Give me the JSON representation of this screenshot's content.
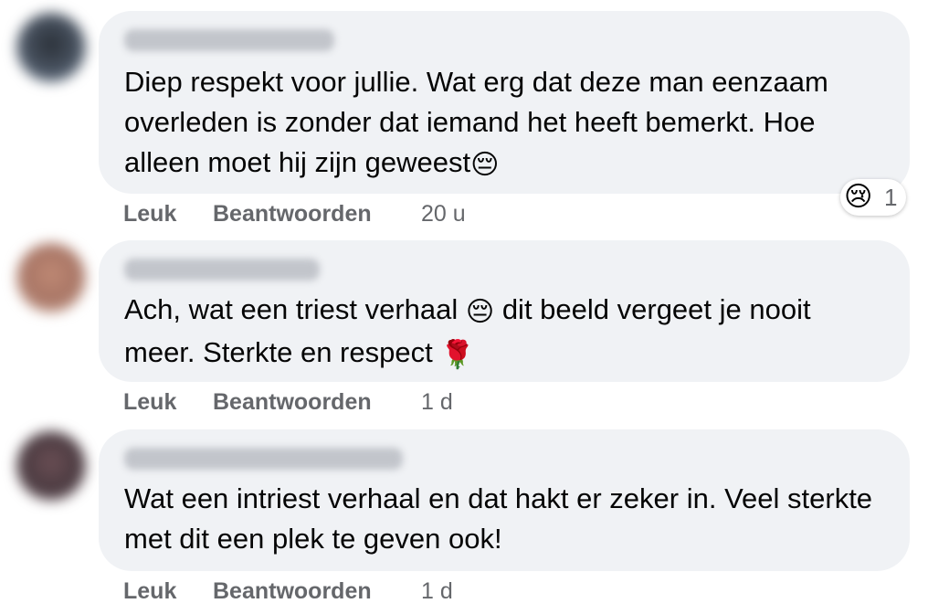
{
  "comments": [
    {
      "text": "Diep respekt voor jullie. Wat erg dat deze man eenzaam overleden is zonder dat iemand het heeft bemerkt. Hoe alleen moet hij zijn geweest",
      "emoji": "😔",
      "like_label": "Leuk",
      "reply_label": "Beantwoorden",
      "time": "20 u",
      "avatar_color": "#3d4550",
      "reaction": {
        "emoji": "😢",
        "count": "1"
      }
    },
    {
      "text_part1": "Ach, wat een triest verhaal ",
      "emoji1": "😔",
      "text_part2": " dit beeld vergeet je nooit meer. Sterkte en respect ",
      "emoji2": "🌹",
      "like_label": "Leuk",
      "reply_label": "Beantwoorden",
      "time": "1 d",
      "avatar_color": "#b07a68"
    },
    {
      "text": "Wat een intriest verhaal en dat hakt er zeker in. Veel sterkte met dit een plek te geven ook!",
      "like_label": "Leuk",
      "reply_label": "Beantwoorden",
      "time": "1 d",
      "avatar_color": "#5a4448"
    }
  ]
}
